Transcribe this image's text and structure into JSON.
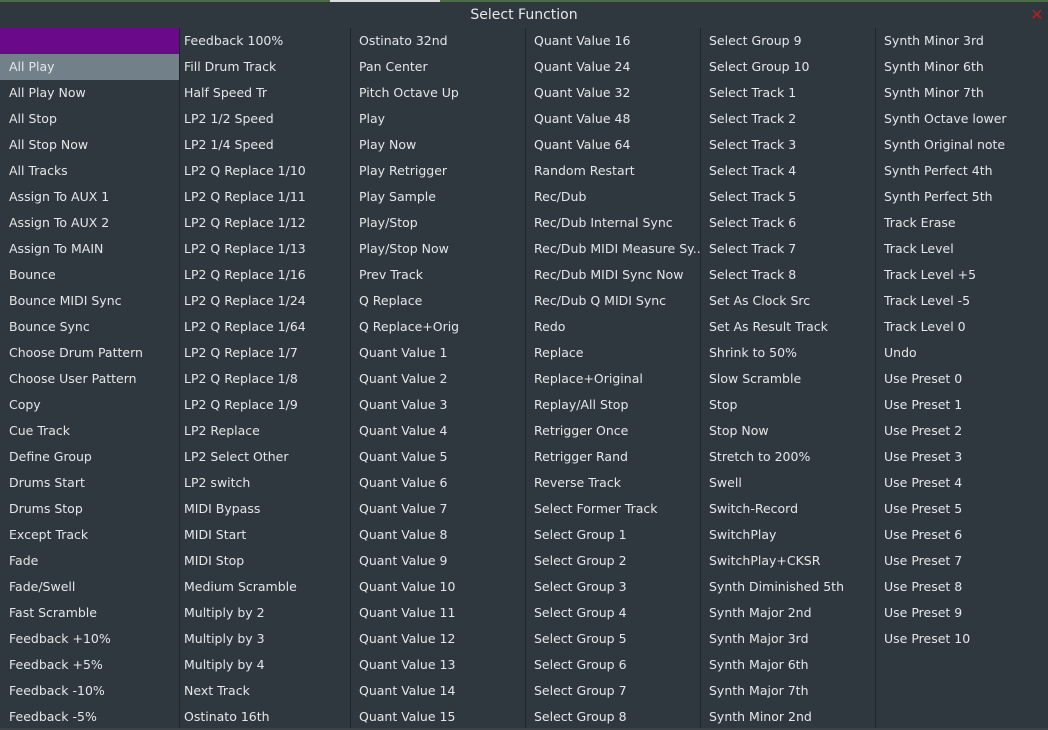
{
  "dialog": {
    "title": "Select Function",
    "close_glyph": "✕"
  },
  "colors": {
    "background": "#2f383e",
    "selected_row": "#72808a",
    "blank_row": "#6a0a8a",
    "text": "#e3e7ea",
    "close": "#b52020"
  },
  "selected_item": "All Play",
  "columns": [
    [
      "",
      "All Play",
      "All Play Now",
      "All Stop",
      "All Stop Now",
      "All Tracks",
      "Assign To AUX 1",
      "Assign To AUX 2",
      "Assign To MAIN",
      "Bounce",
      "Bounce MIDI Sync",
      "Bounce Sync",
      "Choose Drum Pattern",
      "Choose User Pattern",
      "Copy",
      "Cue Track",
      "Define Group",
      "Drums Start",
      "Drums Stop",
      "Except Track",
      "Fade",
      "Fade/Swell",
      "Fast Scramble",
      "Feedback +10%",
      "Feedback +5%",
      "Feedback -10%",
      "Feedback -5%"
    ],
    [
      "Feedback 100%",
      "Fill Drum Track",
      "Half Speed Tr",
      "LP2 1/2 Speed",
      "LP2 1/4 Speed",
      "LP2 Q Replace 1/10",
      "LP2 Q Replace 1/11",
      "LP2 Q Replace 1/12",
      "LP2 Q Replace 1/13",
      "LP2 Q Replace 1/16",
      "LP2 Q Replace 1/24",
      "LP2 Q Replace 1/64",
      "LP2 Q Replace 1/7",
      "LP2 Q Replace 1/8",
      "LP2 Q Replace 1/9",
      "LP2 Replace",
      "LP2 Select Other",
      "LP2 switch",
      "MIDI Bypass",
      "MIDI Start",
      "MIDI Stop",
      "Medium Scramble",
      "Multiply by 2",
      "Multiply by 3",
      "Multiply by 4",
      "Next Track",
      "Ostinato 16th"
    ],
    [
      "Ostinato 32nd",
      "Pan Center",
      "Pitch Octave Up",
      "Play",
      "Play Now",
      "Play Retrigger",
      "Play Sample",
      "Play/Stop",
      "Play/Stop Now",
      "Prev Track",
      "Q Replace",
      "Q Replace+Orig",
      "Quant Value  1",
      "Quant Value  2",
      "Quant Value  3",
      "Quant Value  4",
      "Quant Value  5",
      "Quant Value  6",
      "Quant Value  7",
      "Quant Value  8",
      "Quant Value  9",
      "Quant Value 10",
      "Quant Value 11",
      "Quant Value 12",
      "Quant Value 13",
      "Quant Value 14",
      "Quant Value 15"
    ],
    [
      "Quant Value 16",
      "Quant Value 24",
      "Quant Value 32",
      "Quant Value 48",
      "Quant Value 64",
      "Random Restart",
      "Rec/Dub",
      "Rec/Dub Internal Sync",
      "Rec/Dub MIDI Measure Sy...",
      "Rec/Dub MIDI Sync Now",
      "Rec/Dub Q MIDI Sync",
      "Redo",
      "Replace",
      "Replace+Original",
      "Replay/All Stop",
      "Retrigger Once",
      "Retrigger Rand",
      "Reverse Track",
      "Select Former Track",
      "Select Group  1",
      "Select Group  2",
      "Select Group  3",
      "Select Group  4",
      "Select Group  5",
      "Select Group  6",
      "Select Group  7",
      "Select Group  8"
    ],
    [
      "Select Group  9",
      "Select Group 10",
      "Select Track 1",
      "Select Track 2",
      "Select Track 3",
      "Select Track 4",
      "Select Track 5",
      "Select Track 6",
      "Select Track 7",
      "Select Track 8",
      "Set As Clock Src",
      "Set As Result Track",
      "Shrink to 50%",
      "Slow Scramble",
      "Stop",
      "Stop Now",
      "Stretch to 200%",
      "Swell",
      "Switch-Record",
      "SwitchPlay",
      "SwitchPlay+CKSR",
      "Synth Diminished 5th",
      "Synth Major 2nd",
      "Synth Major 3rd",
      "Synth Major 6th",
      "Synth Major 7th",
      "Synth Minor 2nd"
    ],
    [
      "Synth Minor 3rd",
      "Synth Minor 6th",
      "Synth Minor 7th",
      "Synth Octave lower",
      "Synth Original note",
      "Synth Perfect 4th",
      "Synth Perfect 5th",
      "Track Erase",
      "Track Level",
      "Track Level +5",
      "Track Level -5",
      "Track Level 0",
      "Undo",
      "Use Preset  0",
      "Use Preset  1",
      "Use Preset  2",
      "Use Preset  3",
      "Use Preset  4",
      "Use Preset  5",
      "Use Preset  6",
      "Use Preset  7",
      "Use Preset  8",
      "Use Preset  9",
      "Use Preset 10"
    ]
  ]
}
